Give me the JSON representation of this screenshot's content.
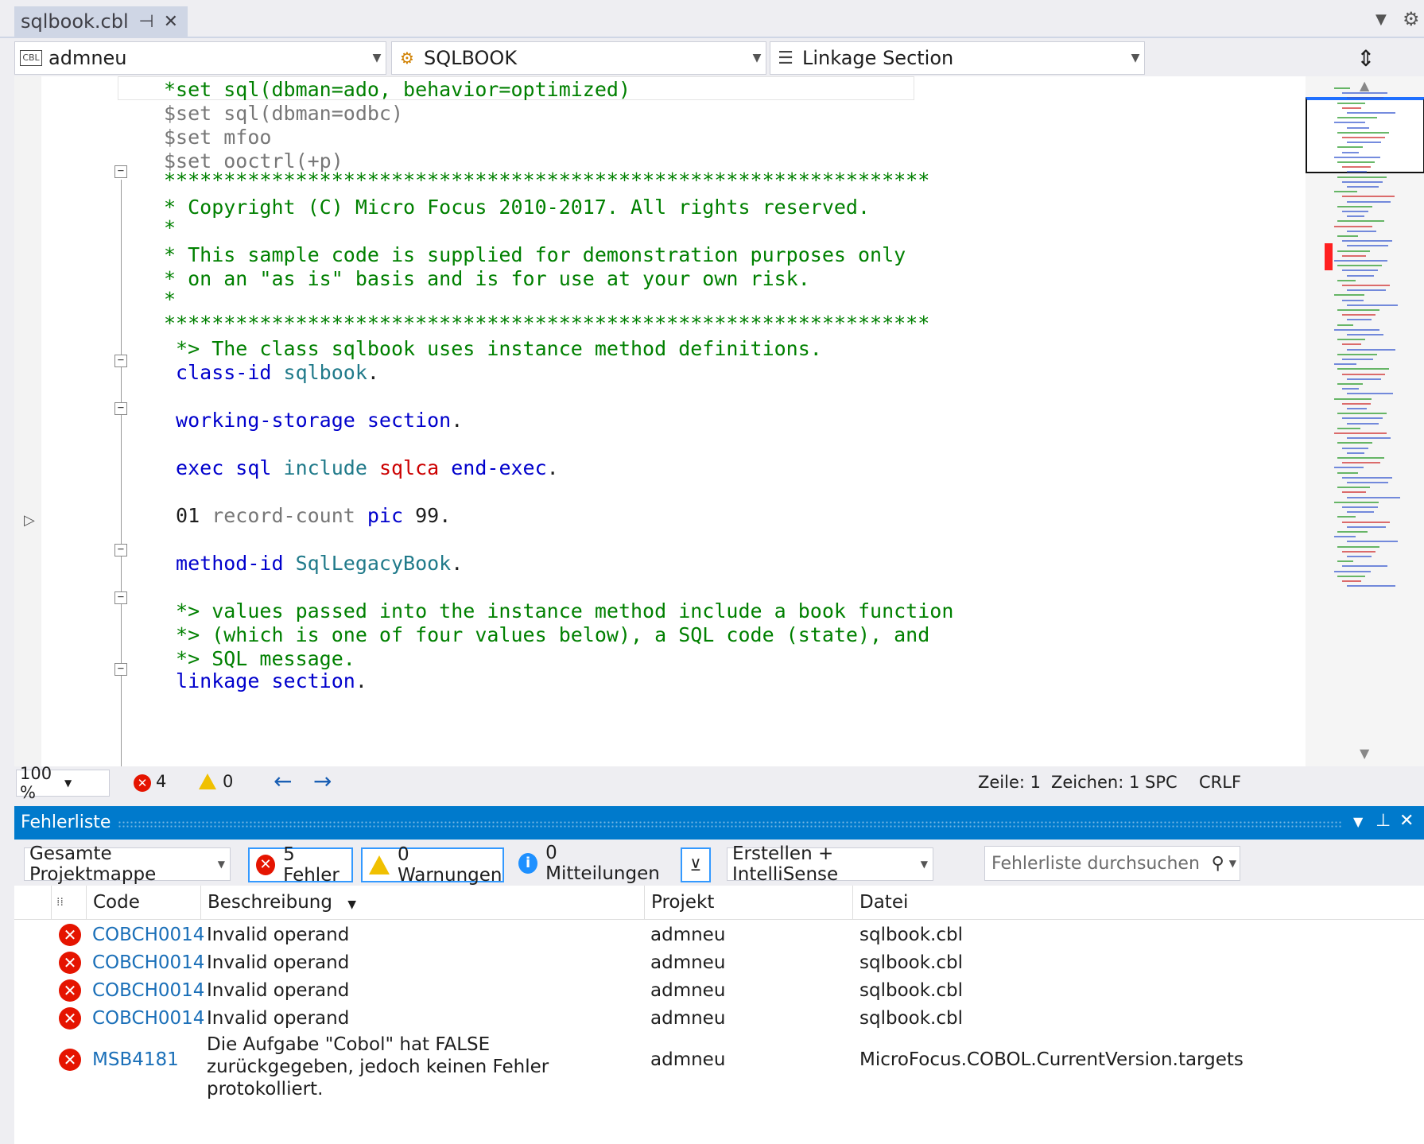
{
  "tab": {
    "title": "sqlbook.cbl",
    "pin_icon": "pin-icon",
    "close_icon": "close-icon"
  },
  "nav": {
    "project": "admneu",
    "class": "SQLBOOK",
    "section": "Linkage Section"
  },
  "code_lines": [
    {
      "parts": [
        {
          "t": "*set sql(dbman=ado, behavior=optimized)",
          "c": "cm"
        }
      ]
    },
    {
      "parts": [
        {
          "t": "$set sql(dbman=odbc)",
          "c": "gy"
        }
      ]
    },
    {
      "parts": [
        {
          "t": "$set mfoo",
          "c": "gy"
        }
      ]
    },
    {
      "parts": [
        {
          "t": "$set ooctrl(+p)",
          "c": "gy"
        }
      ]
    },
    {
      "parts": [
        {
          "t": "****************************************************************",
          "c": "cm"
        }
      ]
    },
    {
      "parts": [
        {
          "t": "* Copyright (C) Micro Focus 2010-2017. All rights reserved.",
          "c": "cm"
        }
      ]
    },
    {
      "parts": [
        {
          "t": "*",
          "c": "cm"
        }
      ]
    },
    {
      "parts": [
        {
          "t": "* This sample code is supplied for demonstration purposes only",
          "c": "cm"
        }
      ]
    },
    {
      "parts": [
        {
          "t": "* on an \"as is\" basis and is for use at your own risk.",
          "c": "cm"
        }
      ]
    },
    {
      "parts": [
        {
          "t": "*",
          "c": "cm"
        }
      ]
    },
    {
      "parts": [
        {
          "t": "****************************************************************",
          "c": "cm"
        }
      ]
    },
    {
      "parts": [
        {
          "t": " *> The class sqlbook uses instance method definitions.",
          "c": "cm"
        }
      ]
    },
    {
      "parts": [
        {
          "t": " class-id",
          "c": "kw"
        },
        {
          "t": " sqlbook",
          "c": "tl"
        },
        {
          "t": ".",
          "c": "bk"
        }
      ]
    },
    {
      "parts": []
    },
    {
      "parts": [
        {
          "t": " working-storage section",
          "c": "kw"
        },
        {
          "t": ".",
          "c": "bk"
        }
      ]
    },
    {
      "parts": []
    },
    {
      "parts": [
        {
          "t": " exec sql",
          "c": "kw"
        },
        {
          "t": " include",
          "c": "tl"
        },
        {
          "t": " sqlca",
          "c": "rd"
        },
        {
          "t": " end-exec",
          "c": "kw"
        },
        {
          "t": ".",
          "c": "bk"
        }
      ]
    },
    {
      "parts": []
    },
    {
      "parts": [
        {
          "t": " 01",
          "c": "bk"
        },
        {
          "t": " record-count",
          "c": "gy"
        },
        {
          "t": " pic",
          "c": "kw"
        },
        {
          "t": " 99.",
          "c": "bk"
        }
      ]
    },
    {
      "parts": []
    },
    {
      "parts": [
        {
          "t": " method-id",
          "c": "kw"
        },
        {
          "t": " SqlLegacyBook",
          "c": "tl"
        },
        {
          "t": ".",
          "c": "bk"
        }
      ]
    },
    {
      "parts": []
    },
    {
      "parts": [
        {
          "t": " *> values passed into the instance method include a book function",
          "c": "cm"
        }
      ]
    },
    {
      "parts": [
        {
          "t": " *> (which is one of four values below), a SQL code (state), and",
          "c": "cm"
        }
      ]
    },
    {
      "parts": [
        {
          "t": " *> SQL message.",
          "c": "cm"
        }
      ]
    },
    {
      "parts": [
        {
          "t": " linkage section",
          "c": "kw"
        },
        {
          "t": ".",
          "c": "bk"
        }
      ]
    }
  ],
  "status": {
    "zoom": "100 %",
    "errors": "4",
    "warnings": "0",
    "line": "Zeile: 1",
    "char": "Zeichen: 1",
    "spc": "SPC",
    "crlf": "CRLF"
  },
  "panel": {
    "title": "Fehlerliste",
    "scope": "Gesamte Projektmappe",
    "errors_btn": "5 Fehler",
    "warnings_btn": "0 Warnungen",
    "messages_btn": "0 Mitteilungen",
    "build_filter": "Erstellen + IntelliSense",
    "search_placeholder": "Fehlerliste durchsuchen",
    "columns": {
      "code": "Code",
      "desc": "Beschreibung",
      "project": "Projekt",
      "file": "Datei"
    },
    "rows": [
      {
        "code": "COBCH0014",
        "desc": "Invalid operand",
        "project": "admneu",
        "file": "sqlbook.cbl"
      },
      {
        "code": "COBCH0014",
        "desc": "Invalid operand",
        "project": "admneu",
        "file": "sqlbook.cbl"
      },
      {
        "code": "COBCH0014",
        "desc": "Invalid operand",
        "project": "admneu",
        "file": "sqlbook.cbl"
      },
      {
        "code": "COBCH0014",
        "desc": "Invalid operand",
        "project": "admneu",
        "file": "sqlbook.cbl"
      },
      {
        "code": "MSB4181",
        "desc": "Die Aufgabe \"Cobol\" hat FALSE zurückgegeben, jedoch keinen Fehler protokolliert.",
        "project": "admneu",
        "file": "MicroFocus.COBOL.CurrentVersion.targets"
      }
    ]
  },
  "colors": {
    "accent": "#007acc",
    "error": "#e51400",
    "comment": "#008000",
    "keyword": "#0000cc"
  }
}
